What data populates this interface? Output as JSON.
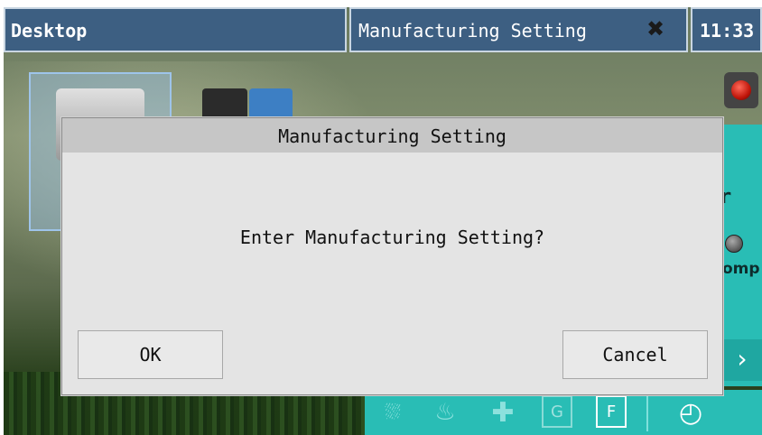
{
  "taskbar": {
    "desktop_label": "Desktop",
    "window_title": "Manufacturing Setting",
    "close_symbol": "✖",
    "clock": "11:33"
  },
  "side_panel": {
    "label": "omp",
    "fragment": "r",
    "next_symbol": "›"
  },
  "bottom_toolbar": {
    "icons": [
      "sprinkler-icon",
      "heater-icon",
      "plus-icon",
      "g-icon",
      "f-icon",
      "clock-icon"
    ],
    "g_label": "G",
    "f_label": "F"
  },
  "dialog": {
    "title": "Manufacturing Setting",
    "message": "Enter Manufacturing Setting?",
    "ok_label": "OK",
    "cancel_label": "Cancel"
  },
  "colors": {
    "taskbar": "#3d5f82",
    "panel_teal": "#29bdb5",
    "dialog_bg": "#e4e4e4",
    "dialog_header": "#c6c6c6"
  }
}
